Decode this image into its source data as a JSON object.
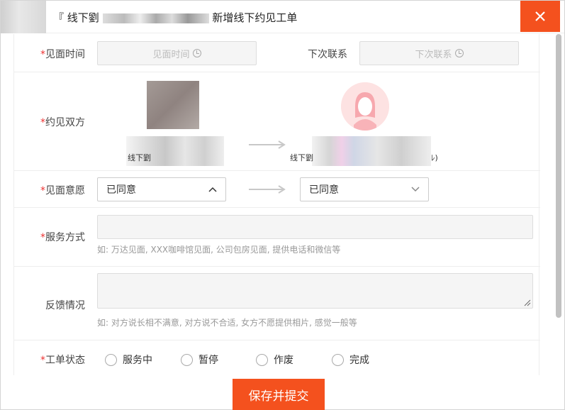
{
  "title": {
    "prefix": "『 线下劉",
    "suffix": "新增线下约见工单"
  },
  "fields": {
    "meet_time": {
      "label": "见面时间",
      "placeholder": "见面时间"
    },
    "next_contact": {
      "label": "下次联系",
      "placeholder": "下次联系"
    },
    "parties": {
      "label": "约见双方",
      "left_name": "线下劉",
      "right_name": "线下劉",
      "right_suffix": "ﾚ)"
    },
    "intent": {
      "label": "见面意愿",
      "left_value": "已同意",
      "right_value": "已同意"
    },
    "service_mode": {
      "label": "服务方式",
      "hint": "如: 万达见面, XXX咖啡馆见面, 公司包房见面, 提供电话和微信等"
    },
    "feedback": {
      "label": "反馈情况",
      "hint": "如: 对方说长相不满意, 对方说不合适, 女方不愿提供相片, 感觉一般等"
    },
    "status": {
      "label": "工单状态",
      "options": [
        "服务中",
        "暂停",
        "作废",
        "完成"
      ]
    }
  },
  "required_mark": "*",
  "save_button": "保存并提交",
  "colors": {
    "accent": "#f4511e",
    "required": "#e33333"
  }
}
